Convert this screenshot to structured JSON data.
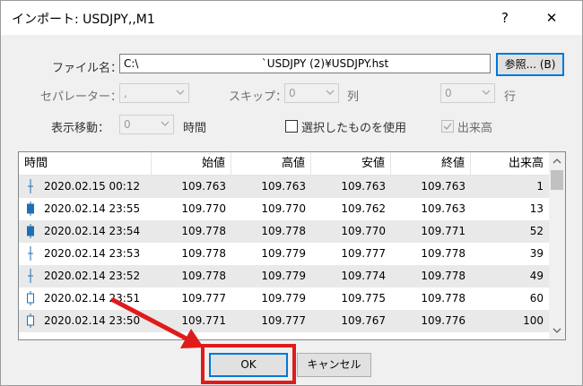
{
  "dialog": {
    "title": "インポート: USDJPY,,M1",
    "help_glyph": "?",
    "close_glyph": "✕"
  },
  "file": {
    "label": "ファイル名：",
    "value": "C:\\                                    `USDJPY (2)¥USDJPY.hst",
    "browse_label": "参照... (B)"
  },
  "options": {
    "separator_label": "セパレーター：",
    "separator_value": ",",
    "skip_label": "スキップ：",
    "skip_value": "0",
    "column_unit": "列",
    "row_value": "0",
    "row_unit": "行",
    "shift_label": "表示移動：",
    "shift_value": "0",
    "shift_unit": "時間",
    "use_selected_label": "選択したものを使用",
    "volume_label": "出来高"
  },
  "table": {
    "columns": [
      "時間",
      "始値",
      "高値",
      "安値",
      "終値",
      "出来高"
    ],
    "rows": [
      {
        "icon": "bar-flat-icon",
        "time": "2020.02.15 00:12",
        "open": "109.763",
        "high": "109.763",
        "low": "109.763",
        "close": "109.763",
        "volume": "1"
      },
      {
        "icon": "candle-down-icon",
        "time": "2020.02.14 23:55",
        "open": "109.770",
        "high": "109.770",
        "low": "109.762",
        "close": "109.763",
        "volume": "13"
      },
      {
        "icon": "candle-down-icon",
        "time": "2020.02.14 23:54",
        "open": "109.778",
        "high": "109.778",
        "low": "109.770",
        "close": "109.771",
        "volume": "52"
      },
      {
        "icon": "bar-flat-icon",
        "time": "2020.02.14 23:53",
        "open": "109.778",
        "high": "109.779",
        "low": "109.777",
        "close": "109.778",
        "volume": "39"
      },
      {
        "icon": "bar-flat-icon",
        "time": "2020.02.14 23:52",
        "open": "109.778",
        "high": "109.779",
        "low": "109.774",
        "close": "109.778",
        "volume": "49"
      },
      {
        "icon": "candle-up-icon",
        "time": "2020.02.14 23:51",
        "open": "109.777",
        "high": "109.779",
        "low": "109.775",
        "close": "109.778",
        "volume": "60"
      },
      {
        "icon": "candle-up-icon",
        "time": "2020.02.14 23:50",
        "open": "109.771",
        "high": "109.777",
        "low": "109.767",
        "close": "109.776",
        "volume": "100"
      }
    ]
  },
  "buttons": {
    "ok_label": "OK",
    "cancel_label": "キャンセル"
  },
  "colors": {
    "highlight": "#e01b1b",
    "focus": "#0078d7",
    "candle": "#1f6fb5"
  }
}
